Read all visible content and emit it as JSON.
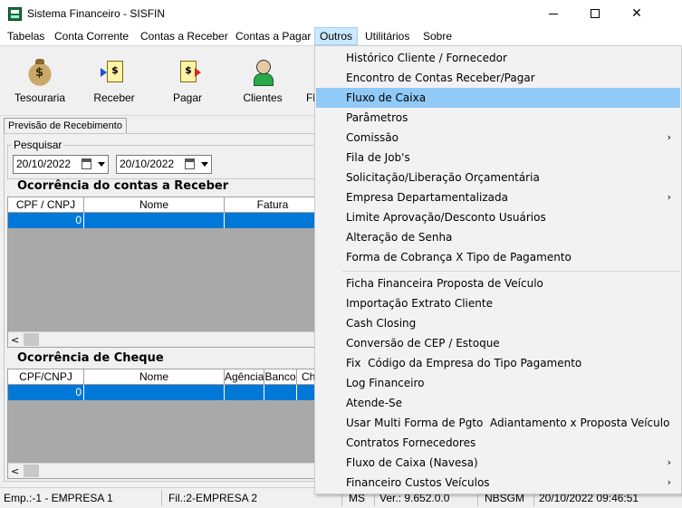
{
  "window": {
    "title": "Sistema Financeiro - SISFIN",
    "app_icon": "sisfin-app-icon"
  },
  "title_buttons": {
    "minimize": "minimize-icon",
    "maximize": "maximize-icon",
    "close": "✕"
  },
  "menubar": {
    "items": [
      "Tabelas",
      "Conta Corrente",
      "Contas a Receber",
      "Contas a Pagar",
      "Outros",
      "Utilitários",
      "Sobre"
    ],
    "active": "Outros"
  },
  "toolbar": {
    "items": [
      {
        "label": "Tesouraria",
        "icon": "money-bag-icon"
      },
      {
        "label": "Receber",
        "icon": "receive-document-icon"
      },
      {
        "label": "Pagar",
        "icon": "pay-document-icon"
      },
      {
        "label": "Clientes",
        "icon": "person-icon"
      },
      {
        "label": "Fl",
        "icon": ""
      }
    ]
  },
  "tab": {
    "label": "Previsão de Recebimento"
  },
  "search": {
    "group_label": "Pesquisar",
    "date_from": "20/10/2022",
    "date_to": "20/10/2022"
  },
  "receber": {
    "title": "Ocorrência do contas a Receber",
    "columns": [
      "CPF / CNPJ",
      "Nome",
      "Fatura"
    ],
    "row": {
      "cpf": "0"
    }
  },
  "cheque": {
    "title": "Ocorrência de Cheque",
    "columns": [
      "CPF/CNPJ",
      "Nome",
      "Agência",
      "Banco",
      "Ch"
    ],
    "row": {
      "cpf": "0"
    }
  },
  "statusbar": {
    "empresa": "Emp.:-1 - EMPRESA 1",
    "filial": "Fil.:2-EMPRESA 2",
    "ms": "MS",
    "versao": "Ver.: 9.652.0.0",
    "user": "NBSGM",
    "datetime": "20/10/2022 09:46:51"
  },
  "dropdown": {
    "highlighted": "Fluxo de Caixa",
    "group1": [
      {
        "label": "Histórico Cliente / Fornecedor",
        "submenu": false
      },
      {
        "label": "Encontro de Contas Receber/Pagar",
        "submenu": false
      },
      {
        "label": "Fluxo de Caixa",
        "submenu": false
      },
      {
        "label": "Parâmetros",
        "submenu": false
      },
      {
        "label": "Comissão",
        "submenu": true
      },
      {
        "label": "Fila de Job's",
        "submenu": false
      },
      {
        "label": "Solicitação/Liberação Orçamentária",
        "submenu": false
      },
      {
        "label": "Empresa Departamentalizada",
        "submenu": true
      },
      {
        "label": "Limite Aprovação/Desconto Usuários",
        "submenu": false
      },
      {
        "label": "Alteração de Senha",
        "submenu": false
      },
      {
        "label": "Forma de Cobrança X Tipo de Pagamento",
        "submenu": false
      }
    ],
    "group2": [
      {
        "label": "Ficha Financeira Proposta de Veículo",
        "submenu": false
      },
      {
        "label": "Importação Extrato Cliente",
        "submenu": false
      },
      {
        "label": "Cash Closing",
        "submenu": false
      },
      {
        "label": "Conversão de CEP / Estoque",
        "submenu": false
      },
      {
        "label": "Fix  Código da Empresa do Tipo Pagamento",
        "submenu": false
      },
      {
        "label": "Log Financeiro",
        "submenu": false
      },
      {
        "label": "Atende-Se",
        "submenu": false
      },
      {
        "label": "Usar Multi Forma de Pgto  Adiantamento x Proposta Veículo",
        "submenu": false
      },
      {
        "label": "Contratos Fornecedores",
        "submenu": false
      },
      {
        "label": "Fluxo de Caixa (Navesa)",
        "submenu": true
      },
      {
        "label": "Financeiro Custos Veículos",
        "submenu": true
      }
    ],
    "submenu_glyph": "›"
  }
}
